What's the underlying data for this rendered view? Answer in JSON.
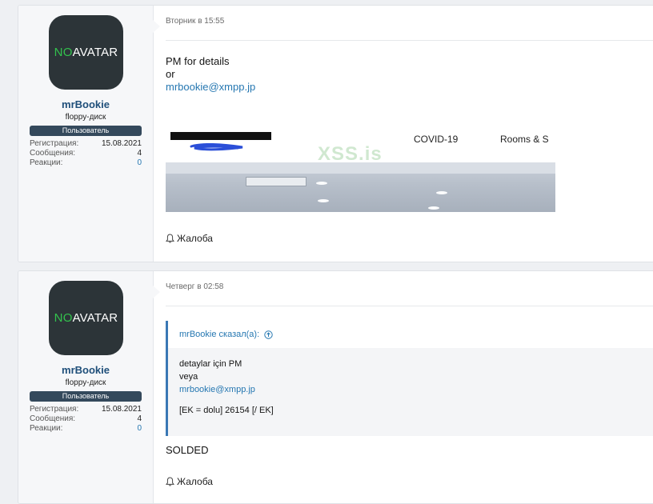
{
  "posts": [
    {
      "user": {
        "avatar_text_1": "NO",
        "avatar_text_2": " AVATAR",
        "name": "mrBookie",
        "title": "floppy-диск",
        "banner": "Пользователь",
        "stats": [
          {
            "label": "Регистрация:",
            "value": "15.08.2021"
          },
          {
            "label": "Сообщения:",
            "value": "4"
          },
          {
            "label": "Реакции:",
            "value": "0"
          }
        ]
      },
      "date": "Вторник в 15:55",
      "lines": [
        "PM for details",
        "or"
      ],
      "email": "mrbookie@xmpp.jp",
      "promo": {
        "link1": "COVID-19",
        "link2": "Rooms & S"
      },
      "watermark": "XSS.is",
      "report": "Жалоба"
    },
    {
      "user": {
        "avatar_text_1": "NO",
        "avatar_text_2": " AVATAR",
        "name": "mrBookie",
        "title": "floppy-диск",
        "banner": "Пользователь",
        "stats": [
          {
            "label": "Регистрация:",
            "value": "15.08.2021"
          },
          {
            "label": "Сообщения:",
            "value": "4"
          },
          {
            "label": "Реакции:",
            "value": "0"
          }
        ]
      },
      "date": "Четверг в 02:58",
      "quote": {
        "author": "mrBookie сказал(а):",
        "line1": "detaylar için PM",
        "line2": "veya",
        "email": "mrbookie@xmpp.jp",
        "line4": "[EK = dolu] 26154 [/ EK]"
      },
      "after_quote": "SOLDED",
      "report": "Жалоба"
    }
  ],
  "colors": {
    "accent": "#2577b1",
    "banner": "#34495c",
    "avatar_bg": "#2c3438",
    "avatar_green": "#33c24d"
  }
}
